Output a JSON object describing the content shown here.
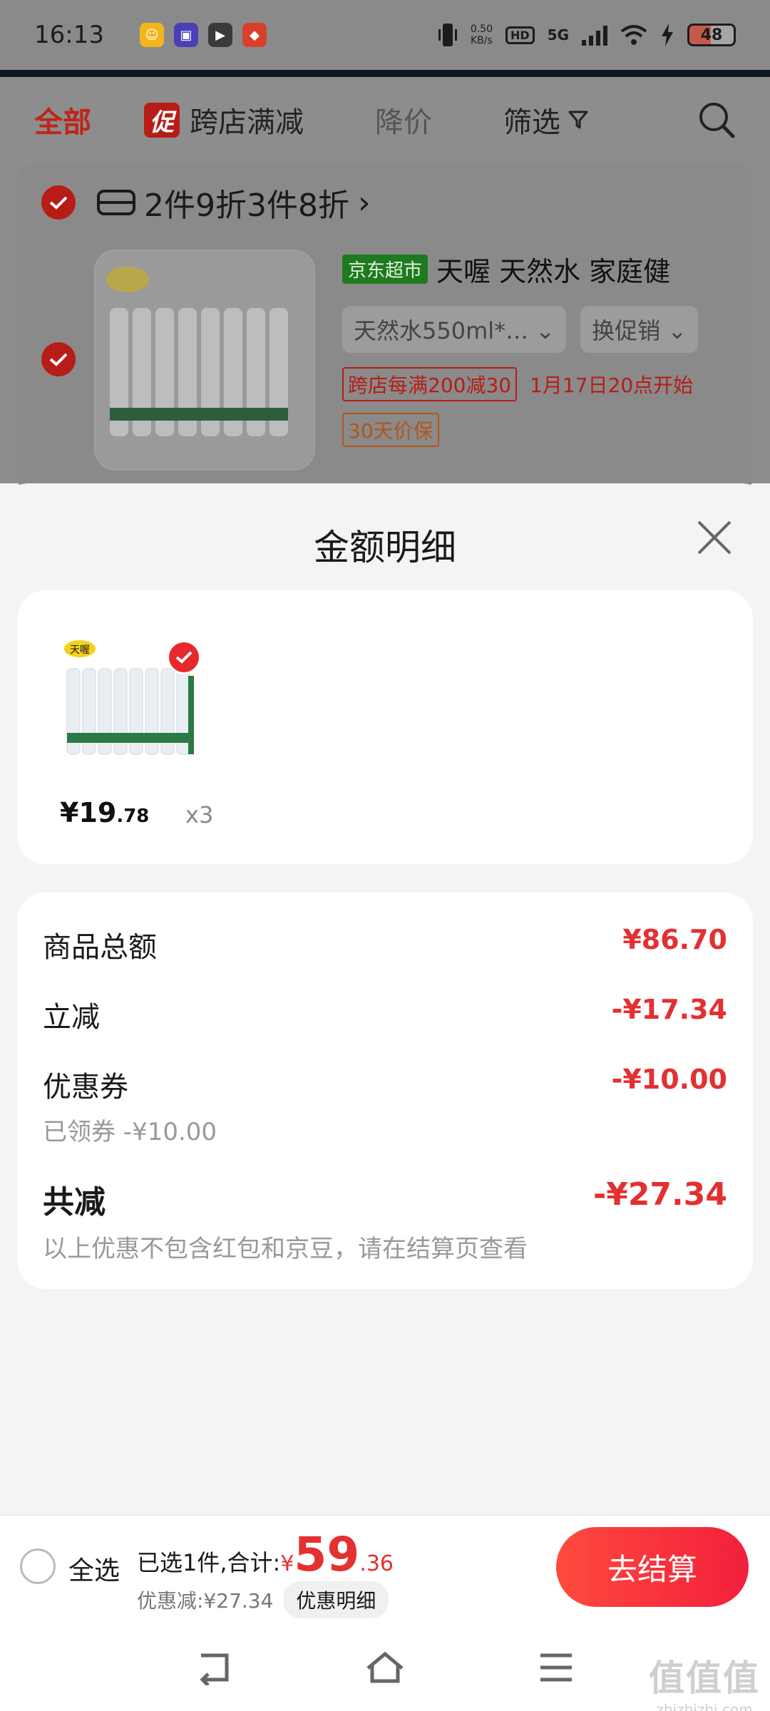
{
  "status_bar": {
    "time": "16:13",
    "net_speed_value": "0.50",
    "net_speed_unit": "KB/s",
    "hd": "HD",
    "network": "5G",
    "battery": "48",
    "app_icons": [
      "app-icon-1",
      "app-icon-2",
      "app-icon-3",
      "app-icon-4"
    ]
  },
  "background_page": {
    "tabs": {
      "all": "全部",
      "promo_badge": "促",
      "promo": "跨店满减",
      "price_drop": "降价",
      "filter": "筛选"
    },
    "group_label": "2件9折3件8折",
    "group_arrow": "›",
    "item": {
      "store_badge": "京东超市",
      "title": "天喔 天然水 家庭健",
      "spec": "天然水550ml*…",
      "promo_switch": "换促销",
      "tag_cross_store": "跨店每满200减30",
      "tag_time": "1月17日20点开始",
      "tag_price_protect": "30天价保"
    }
  },
  "sheet": {
    "title": "金额明细",
    "product": {
      "price_symbol": "¥",
      "price_int": "19",
      "price_dec": ".78",
      "quantity": "x3"
    },
    "summary": {
      "goods_total_label": "商品总额",
      "goods_total_value": "¥86.70",
      "instant_discount_label": "立减",
      "instant_discount_value": "-¥17.34",
      "coupon_label": "优惠券",
      "coupon_value": "-¥10.00",
      "coupon_sub": "已领券 -¥10.00",
      "total_reduce_label": "共减",
      "total_reduce_value": "-¥27.34",
      "total_reduce_note": "以上优惠不包含红包和京豆，请在结算页查看"
    }
  },
  "bottom_bar": {
    "select_all": "全选",
    "selected_text": "已选1件,合计:",
    "total_currency": "¥",
    "total_int": "59",
    "total_dec": ".36",
    "discount_text": "优惠减:¥27.34",
    "detail_button": "优惠明细",
    "checkout_button": "去结算"
  },
  "watermark": {
    "big": "值值值",
    "small": "zhizhizhi.com"
  },
  "colors": {
    "accent_red": "#e33030",
    "checkout_gradient_start": "#ff4a3d",
    "checkout_gradient_end": "#f21f3c"
  }
}
